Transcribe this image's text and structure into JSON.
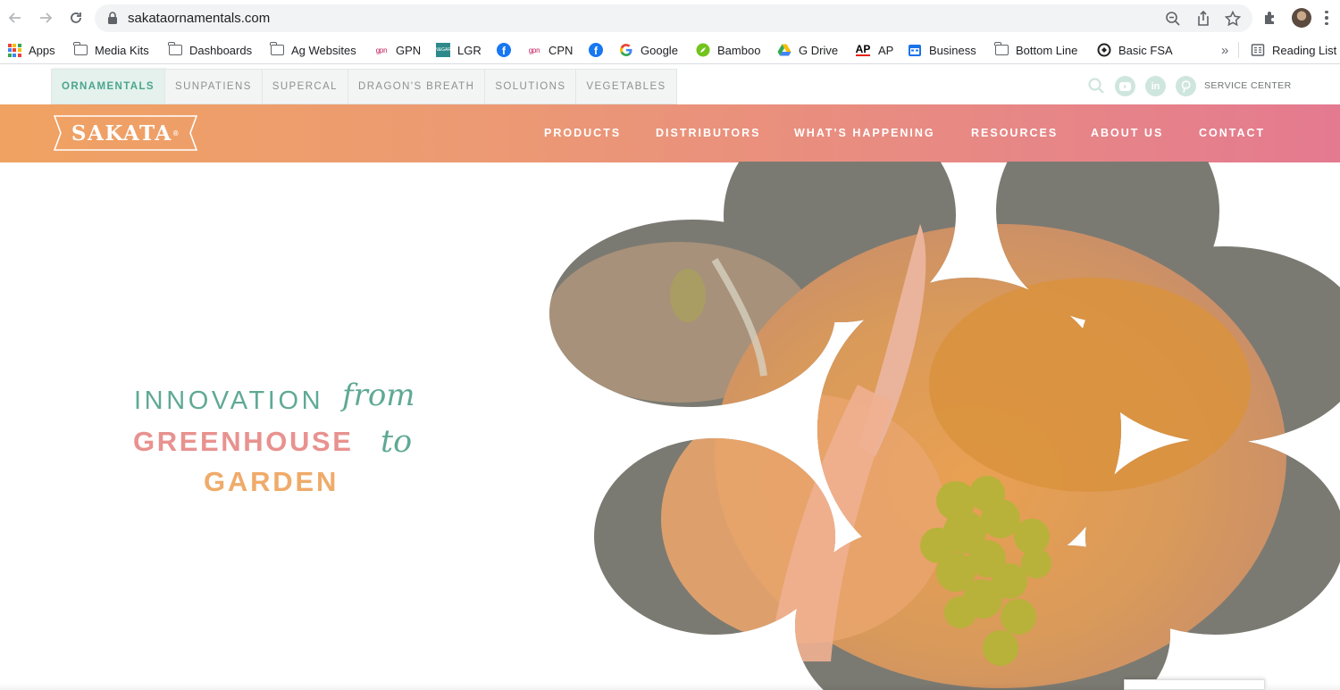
{
  "browser": {
    "url": "sakataornamentals.com",
    "bookmarks": [
      {
        "label": "Apps",
        "icon": "apps-grid-icon"
      },
      {
        "label": "Media Kits",
        "icon": "folder-icon"
      },
      {
        "label": "Dashboards",
        "icon": "folder-icon"
      },
      {
        "label": "Ag Websites",
        "icon": "folder-icon"
      },
      {
        "label": "GPN",
        "icon": "gpn-icon"
      },
      {
        "label": "LGR",
        "icon": "lgr-icon"
      },
      {
        "label": "",
        "icon": "facebook-icon"
      },
      {
        "label": "CPN",
        "icon": "gpn-icon"
      },
      {
        "label": "",
        "icon": "facebook-icon"
      },
      {
        "label": "Google",
        "icon": "google-icon"
      },
      {
        "label": "Bamboo",
        "icon": "bamboo-icon"
      },
      {
        "label": "G Drive",
        "icon": "google-drive-icon"
      },
      {
        "label": "AP",
        "icon": "ap-icon"
      },
      {
        "label": "Business",
        "icon": "calendar-icon"
      },
      {
        "label": "Bottom Line",
        "icon": "folder-icon"
      },
      {
        "label": "Basic FSA",
        "icon": "fsa-icon"
      }
    ],
    "overflow_label": "»",
    "reading_list": "Reading List",
    "gpn_glyph": "gpn",
    "lgr_glyph": "LAWN&GARDEN",
    "ap_glyph": "AP"
  },
  "site": {
    "brand_tabs": [
      {
        "label": "ORNAMENTALS",
        "active": true
      },
      {
        "label": "SUNPATIENS",
        "active": false
      },
      {
        "label": "SUPERCAL",
        "active": false
      },
      {
        "label": "DRAGON'S BREATH",
        "active": false
      },
      {
        "label": "SOLUTIONS",
        "active": false
      },
      {
        "label": "VEGETABLES",
        "active": false
      }
    ],
    "service_center": "SERVICE CENTER",
    "social": {
      "linkedin": "in"
    },
    "logo_text": "SAKATA",
    "logo_mark": "®",
    "menu": [
      "PRODUCTS",
      "DISTRIBUTORS",
      "WHAT'S HAPPENING",
      "RESOURCES",
      "ABOUT US",
      "CONTACT"
    ],
    "hero": {
      "line1": "INNOVATION",
      "script1": "from",
      "line2": "GREENHOUSE",
      "script2": "to",
      "line3": "GARDEN"
    }
  },
  "colors": {
    "accent_teal": "#5fa995",
    "coral": "#e8928f",
    "orange": "#efab6a",
    "bar_start": "#f0a262",
    "bar_end": "#e47a90"
  }
}
